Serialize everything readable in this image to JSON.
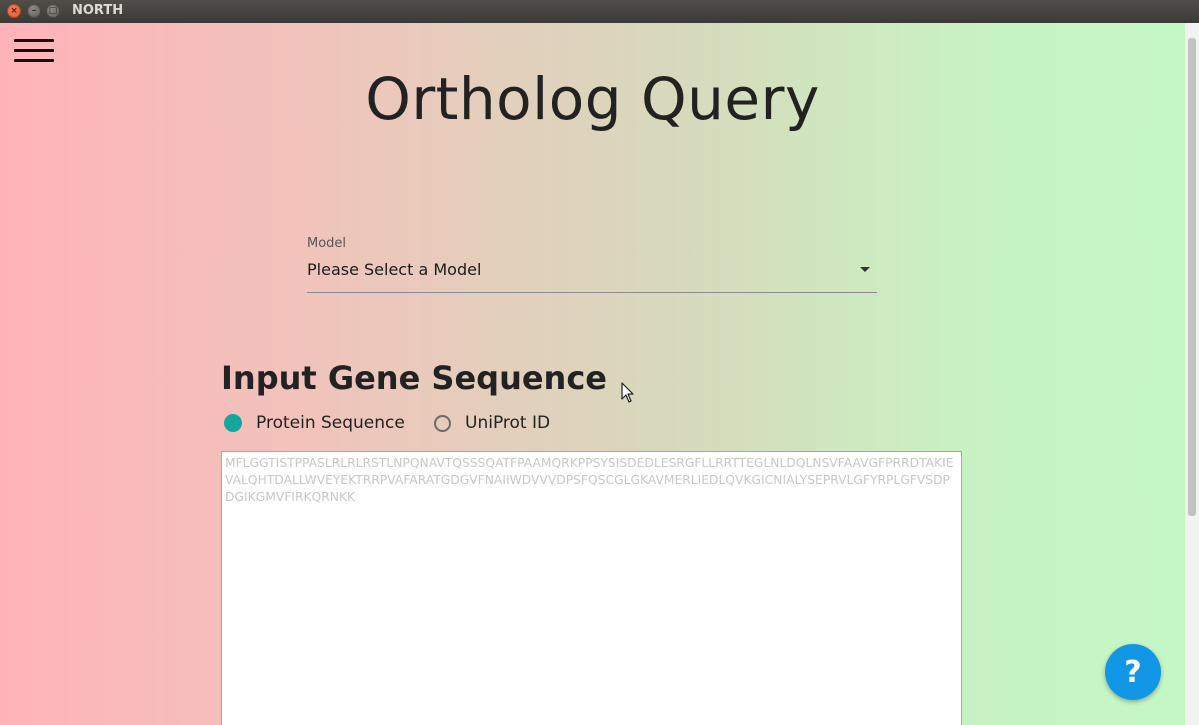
{
  "window": {
    "title": "NORTH",
    "close_glyph": "×",
    "minimize_glyph": "–",
    "maximize_glyph": "□"
  },
  "page": {
    "title": "Ortholog Query"
  },
  "model": {
    "label": "Model",
    "selected": "Please Select a Model"
  },
  "input_section": {
    "title": "Input Gene Sequence",
    "options": [
      {
        "label": "Protein Sequence",
        "checked": true
      },
      {
        "label": "UniProt ID",
        "checked": false
      }
    ],
    "placeholder": "MFLGGTISTPPASLRLRLRSTLNPQNAVTQSSSQATFPAAMQRKPPSYSISDEDLESRGFLLRRTTEGLNLDQLNSVFAAVGFPRRDTAKIEVALQHTDALLWVEYEKTRRPVAFARATGDGVFNAIIWDVVVDPSFQSCGLGKAVMERLIEDLQVKGICNIALYSEPRVLGFYRPLGFVSDPDGIKGMVFIRKQRNKK",
    "value": ""
  },
  "help": {
    "label": "?"
  },
  "colors": {
    "accent_radio": "#13a89e",
    "fab": "#1297e6",
    "gradient_left": "#ffb3b9",
    "gradient_right": "#c5f7c5"
  },
  "icons": [
    "hamburger-menu-icon",
    "dropdown-arrow-icon",
    "help-icon"
  ]
}
